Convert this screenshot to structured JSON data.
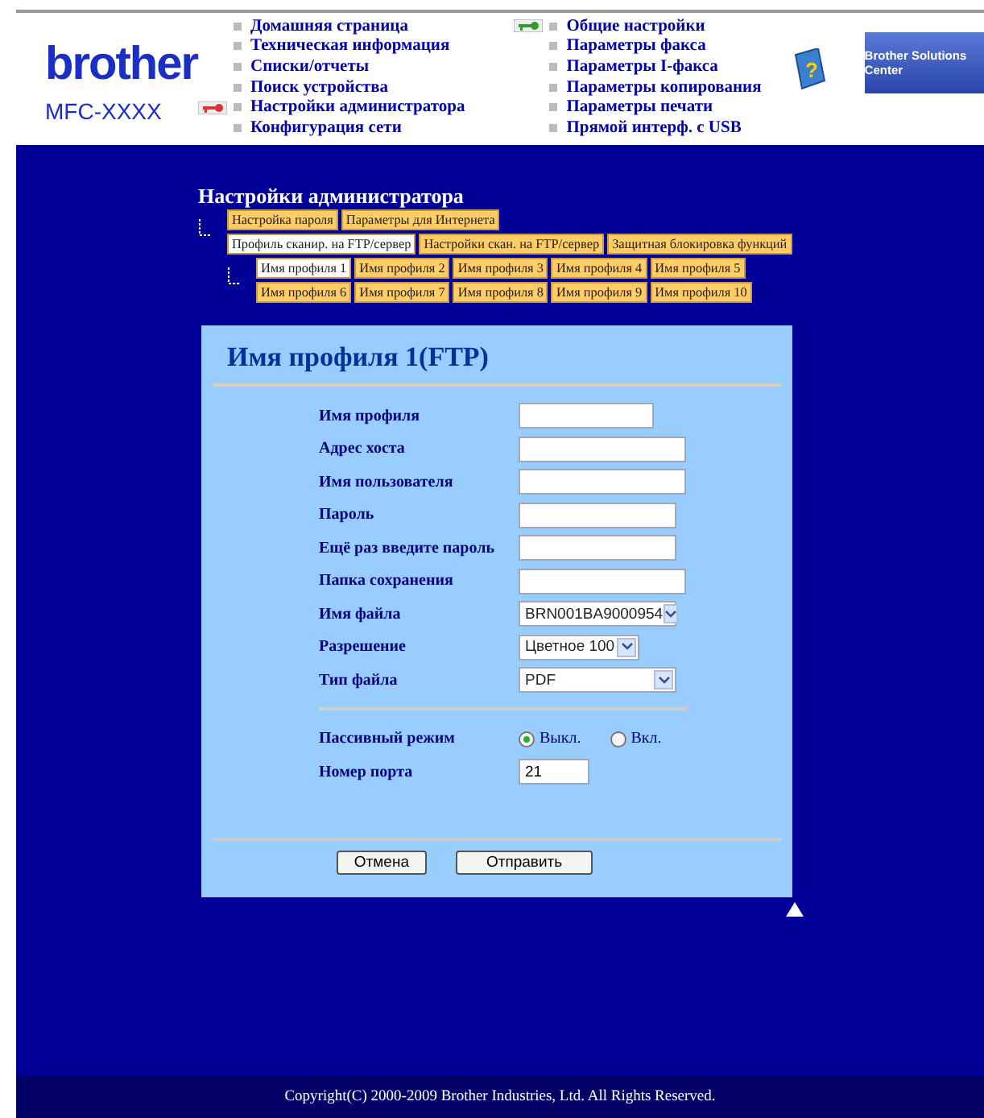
{
  "header": {
    "logo": "brother",
    "model": "MFC-XXXX",
    "nav_left": [
      {
        "label": "Домашняя страница",
        "current": false
      },
      {
        "label": "Техническая информация",
        "current": false
      },
      {
        "label": "Списки/отчеты",
        "current": false
      },
      {
        "label": "Поиск устройства",
        "current": false
      },
      {
        "label": "Настройки администратора",
        "current": true
      },
      {
        "label": "Конфигурация сети",
        "current": false
      }
    ],
    "nav_right": [
      {
        "label": "Общие настройки"
      },
      {
        "label": "Параметры факса"
      },
      {
        "label": "Параметры I-факса"
      },
      {
        "label": "Параметры копирования"
      },
      {
        "label": "Параметры печати"
      },
      {
        "label": "Прямой интерф. с USB"
      }
    ],
    "help_icon": "?",
    "banner": "Brother Solutions Center"
  },
  "admin": {
    "title": "Настройки администратора",
    "tab_rows": [
      [
        {
          "label": "Настройка пароля",
          "selected": false
        },
        {
          "label": "Параметры для Интернета",
          "selected": false
        }
      ],
      [
        {
          "label": "Профиль сканир. на FTP/сервер",
          "selected": true
        },
        {
          "label": "Настройки скан. на FTP/сервер",
          "selected": false
        },
        {
          "label": "Защитная блокировка функций",
          "selected": false
        }
      ]
    ],
    "profile_rows": [
      [
        {
          "label": "Имя профиля 1",
          "selected": true
        },
        {
          "label": "Имя профиля 2",
          "selected": false
        },
        {
          "label": "Имя профиля 3",
          "selected": false
        },
        {
          "label": "Имя профиля 4",
          "selected": false
        },
        {
          "label": "Имя профиля 5",
          "selected": false
        }
      ],
      [
        {
          "label": "Имя профиля 6",
          "selected": false
        },
        {
          "label": "Имя профиля 7",
          "selected": false
        },
        {
          "label": "Имя профиля 8",
          "selected": false
        },
        {
          "label": "Имя профиля 9",
          "selected": false
        },
        {
          "label": "Имя профиля 10",
          "selected": false
        }
      ]
    ]
  },
  "form": {
    "title": "Имя профиля 1(FTP)",
    "fields": [
      {
        "kind": "text",
        "label": "Имя профиля"
      },
      {
        "kind": "text",
        "label": "Адрес хоста"
      },
      {
        "kind": "text",
        "label": "Имя пользователя"
      },
      {
        "kind": "text",
        "label": "Пароль"
      },
      {
        "kind": "text",
        "label": "Ещё раз введите пароль"
      },
      {
        "kind": "text",
        "label": "Папка сохранения"
      },
      {
        "kind": "select",
        "label": "Имя файла",
        "value": "BRN001BA9000954"
      },
      {
        "kind": "select",
        "label": "Разрешение",
        "value": "Цветное 100"
      },
      {
        "kind": "select",
        "label": "Тип файла",
        "value": "PDF"
      }
    ],
    "passive": {
      "label": "Пассивный режим",
      "options": [
        {
          "label": "Выкл.",
          "selected": true
        },
        {
          "label": "Вкл.",
          "selected": false
        }
      ]
    },
    "port": {
      "label": "Номер порта",
      "value": "21"
    },
    "buttons": [
      "Отмена",
      "Отправить"
    ]
  },
  "footer": "Copyright(C) 2000-2009 Brother Industries, Ltd. All Rights Reserved."
}
